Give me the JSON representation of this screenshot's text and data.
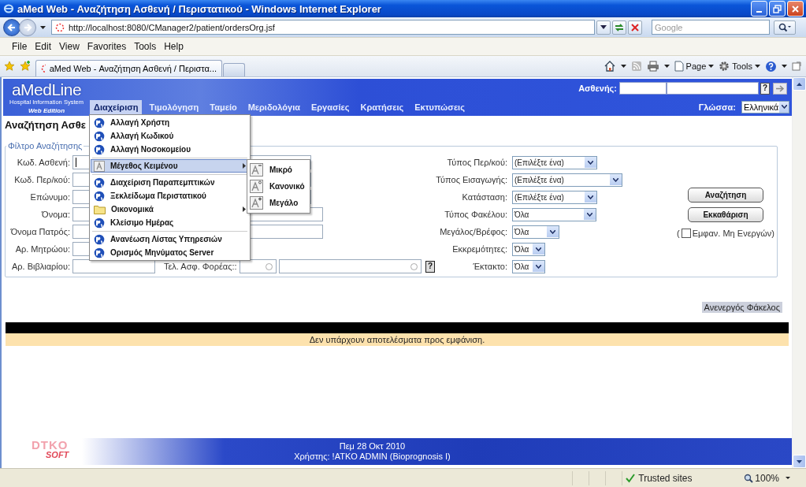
{
  "window": {
    "title": "aMed Web - Αναζήτηση Ασθενή / Περιστατικού - Windows Internet Explorer"
  },
  "address_bar": {
    "url": "http://localhost:8080/CManager2/patient/ordersOrg.jsf",
    "search_placeholder": "Google"
  },
  "menu_bar": [
    "File",
    "Edit",
    "View",
    "Favorites",
    "Tools",
    "Help"
  ],
  "tabs": [
    {
      "label": "aMed Web - Αναζήτηση Ασθενή / Περιστα...",
      "selected": true
    }
  ],
  "command_bar": [
    "Page",
    "Tools"
  ],
  "app_header": {
    "logo": "aMedLine",
    "subtitle": "Hospital Information System",
    "edition": "Web Edition",
    "patient_label": "Ασθενής:",
    "help_key": "?",
    "language_label": "Γλώσσα:",
    "language": "Ελληνικά"
  },
  "nav": [
    {
      "label": "Διαχείριση",
      "selected": true
    },
    {
      "label": "Τιμολόγηση",
      "selected": false
    },
    {
      "label": "Ταμείο",
      "selected": false
    },
    {
      "label": "Μεριδολόγια",
      "selected": false
    },
    {
      "label": "Εργασίες",
      "selected": false
    },
    {
      "label": "Κρατήσεις",
      "selected": false
    },
    {
      "label": "Εκτυπώσεις",
      "selected": false
    }
  ],
  "menu": [
    {
      "kind": "action",
      "label": "Αλλαγή Χρήστη",
      "submenu": false,
      "selected": false
    },
    {
      "kind": "action",
      "label": "Αλλαγή Κωδικού",
      "submenu": false,
      "selected": false
    },
    {
      "kind": "action",
      "label": "Αλλαγή Νοσοκομείου",
      "submenu": false,
      "selected": false
    },
    {
      "kind": "separator"
    },
    {
      "kind": "text-size",
      "label": "Μέγεθος Κειμένου",
      "submenu": true,
      "selected": true
    },
    {
      "kind": "separator"
    },
    {
      "kind": "action",
      "label": "Διαχείριση Παραπεμπτικών",
      "submenu": false,
      "selected": false
    },
    {
      "kind": "action",
      "label": "Ξεκλείδωμα Περιστατικού",
      "submenu": false,
      "selected": false
    },
    {
      "kind": "folder",
      "label": "Οικονομικά",
      "submenu": true,
      "selected": false
    },
    {
      "kind": "action",
      "label": "Κλείσιμο Ημέρας",
      "submenu": false,
      "selected": false
    },
    {
      "kind": "separator"
    },
    {
      "kind": "action",
      "label": "Ανανέωση Λίστας Υπηρεσιών",
      "submenu": false,
      "selected": false
    },
    {
      "kind": "action",
      "label": "Ορισμός Μηνύματος Server",
      "submenu": false,
      "selected": false
    }
  ],
  "submenu": [
    {
      "kind": "small",
      "label": "Μικρό"
    },
    {
      "kind": "normal",
      "label": "Κανονικό"
    },
    {
      "kind": "large",
      "label": "Μεγάλο"
    }
  ],
  "page_title": "Αναζήτηση Ασθε",
  "filter": {
    "legend": "Φίλτρο Αναζήτησης",
    "fields": [
      {
        "label": "Κωδ. Ασθενή:",
        "focused": true
      },
      {
        "label": "Κωδ. Περ/κού:",
        "focused": false
      },
      {
        "label": "Επώνυμο:",
        "focused": false
      },
      {
        "label": "Όνομα:",
        "focused": false
      },
      {
        "label": "Όνομα Πατρός:",
        "focused": false
      },
      {
        "label": "Αρ. Μητρώου:",
        "focused": false
      },
      {
        "label": "Αρ. Βιβλιαρίου:",
        "focused": false
      }
    ],
    "insurer": {
      "label": "Τελ. Ασφ. Φορέας::",
      "help_key": "?"
    },
    "selects": [
      {
        "label": "Τύπος Περ/κού:",
        "value": "(Επιλέξτε ένα)"
      },
      {
        "label": "Τύπος Εισαγωγής:",
        "value": "(Επιλέξτε ένα)"
      },
      {
        "label": "Κατάσταση:",
        "value": "(Επιλέξτε ένα)"
      },
      {
        "label": "Τύπος Φακέλου:",
        "value": "Όλα"
      },
      {
        "label": "Μεγάλος/Βρέφος:",
        "value": "Όλα"
      },
      {
        "label": "Εκκρεμότητες:",
        "value": "Όλα"
      },
      {
        "label": "Έκτακτο:",
        "value": "Όλα"
      }
    ],
    "buttons": [
      "Αναζήτηση",
      "Εκκαθάριση"
    ],
    "show_inactive": {
      "prefix": "(",
      "label": "Εμφαν. Μη Ενεργών)",
      "checked": false
    }
  },
  "inactive_folder_label": "Ανενεργός Φάκελος",
  "results": {
    "message": "Δεν υπάρχουν αποτελέσματα προς εμφάνιση."
  },
  "footer": {
    "logo_top": "DTKO",
    "logo_bottom": "SOFT",
    "date": "Πεμ 28 Οκτ 2010",
    "user": "Χρήστης: !ATKO ADMIN (Bioprognosis I)"
  },
  "status_bar": {
    "zone": "Trusted sites",
    "zoom": "100%"
  }
}
